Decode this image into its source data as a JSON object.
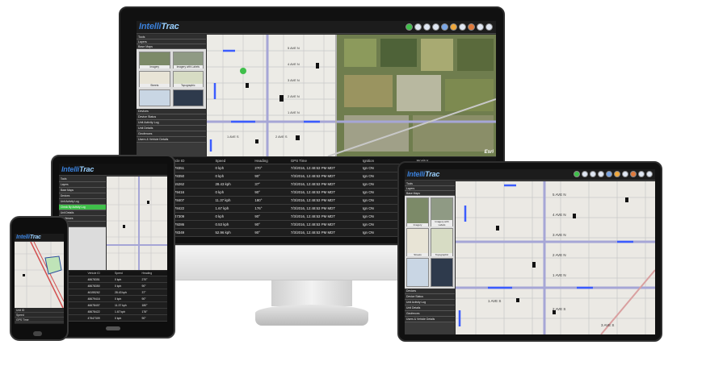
{
  "app": {
    "logo_main": "Intelli",
    "logo_accent": "Trac"
  },
  "colors": {
    "ui_dark": "#2b2b2b",
    "table_bg": "#1e1e1e",
    "route_blue": "#3b5cff",
    "logo_blue": "#3a7fd8",
    "toolbar_green": "#3fbf4a"
  },
  "toolbar_icons": [
    "status-green-icon",
    "zoom-in-icon",
    "zoom-out-icon",
    "home-icon",
    "pan-icon",
    "layers-icon",
    "print-icon",
    "measure-icon",
    "table-icon",
    "settings-icon"
  ],
  "sidebar": {
    "top_rows": [
      "Tools",
      "Layers",
      "Base Maps"
    ],
    "basemaps": [
      "Imagery",
      "Imagery with Labels",
      "Streets",
      "Topographic",
      "",
      ""
    ],
    "bottom_rows": [
      "Devices",
      "Device Status",
      "Unit Activity Log",
      "Unit Details",
      "Geofences",
      "Users & Vehicle Details"
    ]
  },
  "table": {
    "columns": [
      "Unit ID",
      "Vehicle ID",
      "Speed",
      "Heading",
      "GPS Time",
      "Ignition",
      "Monitor"
    ],
    "rows": [
      [
        "75030",
        "48678351",
        "0 kph",
        "270°",
        "7/3/2016, 12:48:53 PM MDT",
        "Ign ON",
        "Plow UP"
      ],
      [
        "75036",
        "48678350",
        "0 kph",
        "90°",
        "7/3/2016, 12:48:53 PM MDT",
        "Ign ON",
        "Plow DOWN"
      ],
      [
        "45123",
        "46155262",
        "28.43 kph",
        "37°",
        "7/3/2016, 12:48:53 PM MDT",
        "Ign ON",
        ""
      ],
      [
        "16078",
        "48679416",
        "0 kph",
        "90°",
        "7/3/2016, 12:48:53 PM MDT",
        "Ign ON",
        ""
      ],
      [
        "93111",
        "46678407",
        "11.37 kph",
        "180°",
        "7/3/2016, 12:48:53 PM MDT",
        "Ign ON",
        "Aux UP"
      ],
      [
        "16281",
        "48678422",
        "1.67 kph",
        "176°",
        "7/3/2016, 12:48:53 PM MDT",
        "Ign ON",
        "Plow DOWN"
      ],
      [
        "73887",
        "47547309",
        "0 kph",
        "90°",
        "7/3/2016, 12:48:53 PM MDT",
        "Ign ON",
        ""
      ],
      [
        "92176",
        "48679286",
        "0.53 kph",
        "90°",
        "7/3/2016, 12:48:53 PM MDT",
        "Ign ON",
        ""
      ],
      [
        "73229",
        "48678349",
        "52.96 kph",
        "90°",
        "7/3/2016, 12:48:53 PM MDT",
        "Ign ON",
        ""
      ]
    ]
  },
  "tablet": {
    "sidebar_rows": [
      "Tools",
      "Layers",
      "Base Maps",
      "Devices",
      "Unit Activity Log",
      "Check By Activity Log",
      "Unit Details",
      "Geofences",
      "Users"
    ],
    "table_columns": [
      "Unit ID",
      "Vehicle ID",
      "Speed",
      "Heading"
    ]
  },
  "phone": {
    "rows": [
      "Unit ID",
      "Speed",
      "GPS Time"
    ]
  },
  "map_labels": {
    "streets_top": [
      "5 AVE N",
      "4 AVE N",
      "3 AVE N",
      "2 AVE N",
      "1 AVE N"
    ],
    "streets_bottom": [
      "1 AVE S",
      "2 AVE S",
      "3 AVE S"
    ],
    "attribution": "Esri"
  }
}
